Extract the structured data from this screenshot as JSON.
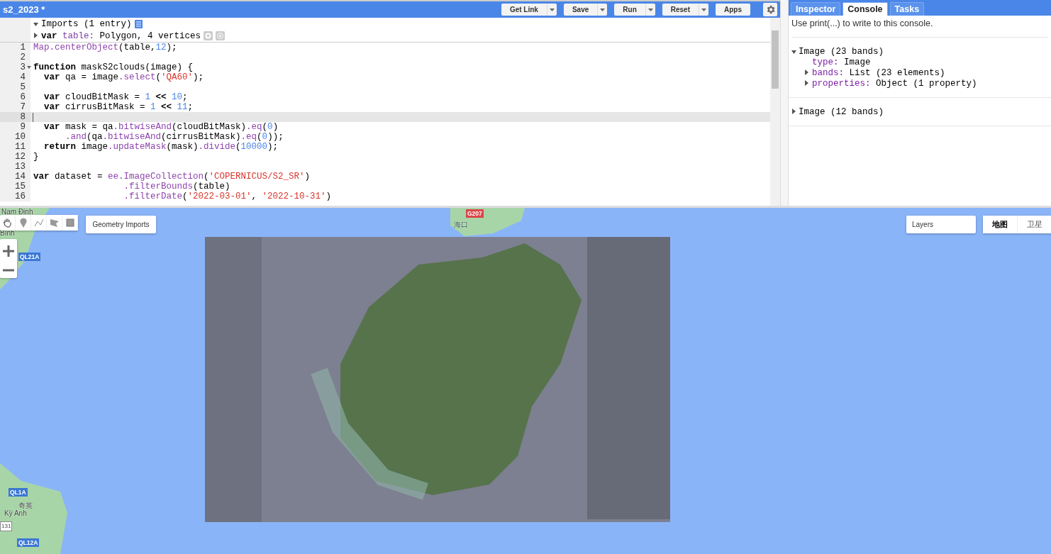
{
  "editor": {
    "title": "s2_2023 *",
    "buttons": [
      {
        "label": "Get Link",
        "dropdown": true
      },
      {
        "label": "Save",
        "dropdown": true
      },
      {
        "label": "Run",
        "dropdown": true
      },
      {
        "label": "Reset",
        "dropdown": true
      },
      {
        "label": "Apps",
        "dropdown": false
      }
    ],
    "imports": {
      "header": "Imports (1 entry)",
      "expanded": true,
      "entry": {
        "keyword": "var",
        "name": "table:",
        "value": "Polygon, 4 vertices",
        "expanded": false
      }
    },
    "lines": [
      {
        "number": "1",
        "foldable": false,
        "current": false,
        "tokens": [
          {
            "kind": "method",
            "text": "Map.centerObject"
          },
          {
            "kind": "plain",
            "text": "(table,"
          },
          {
            "kind": "number",
            "text": "12"
          },
          {
            "kind": "plain",
            "text": ");"
          }
        ]
      },
      {
        "number": "2",
        "foldable": false,
        "current": false
      },
      {
        "number": "3",
        "foldable": true,
        "current": false,
        "tokens": [
          {
            "kind": "keyword",
            "text": "function"
          },
          {
            "kind": "plain",
            "text": " maskS2clouds(image) {"
          }
        ]
      },
      {
        "number": "4",
        "foldable": false,
        "current": false,
        "tokens": [
          {
            "kind": "keyword",
            "text": "  var"
          },
          {
            "kind": "plain",
            "text": " qa = image"
          },
          {
            "kind": "method",
            "text": ".select"
          },
          {
            "kind": "plain",
            "text": "("
          },
          {
            "kind": "string",
            "text": "'QA60'"
          },
          {
            "kind": "plain",
            "text": ");"
          }
        ]
      },
      {
        "number": "5",
        "foldable": false,
        "current": false
      },
      {
        "number": "6",
        "foldable": false,
        "current": false,
        "tokens": [
          {
            "kind": "keyword",
            "text": "  var"
          },
          {
            "kind": "plain",
            "text": " cloudBitMask = "
          },
          {
            "kind": "number",
            "text": "1"
          },
          {
            "kind": "keyword",
            "text": " << "
          },
          {
            "kind": "number",
            "text": "10"
          },
          {
            "kind": "plain",
            "text": ";"
          }
        ]
      },
      {
        "number": "7",
        "foldable": false,
        "current": false,
        "tokens": [
          {
            "kind": "keyword",
            "text": "  var"
          },
          {
            "kind": "plain",
            "text": " cirrusBitMask = "
          },
          {
            "kind": "number",
            "text": "1"
          },
          {
            "kind": "keyword",
            "text": " << "
          },
          {
            "kind": "number",
            "text": "11"
          },
          {
            "kind": "plain",
            "text": ";"
          }
        ]
      },
      {
        "number": "8",
        "foldable": false,
        "current": true
      },
      {
        "number": "9",
        "foldable": false,
        "current": false,
        "tokens": [
          {
            "kind": "keyword",
            "text": "  var"
          },
          {
            "kind": "plain",
            "text": " mask = qa"
          },
          {
            "kind": "method",
            "text": ".bitwiseAnd"
          },
          {
            "kind": "plain",
            "text": "(cloudBitMask)"
          },
          {
            "kind": "method",
            "text": ".eq"
          },
          {
            "kind": "plain",
            "text": "("
          },
          {
            "kind": "number",
            "text": "0"
          },
          {
            "kind": "plain",
            "text": ")"
          }
        ]
      },
      {
        "number": "10",
        "foldable": false,
        "current": false,
        "tokens": [
          {
            "kind": "method",
            "text": "      .and"
          },
          {
            "kind": "plain",
            "text": "(qa"
          },
          {
            "kind": "method",
            "text": ".bitwiseAnd"
          },
          {
            "kind": "plain",
            "text": "(cirrusBitMask)"
          },
          {
            "kind": "method",
            "text": ".eq"
          },
          {
            "kind": "plain",
            "text": "("
          },
          {
            "kind": "number",
            "text": "0"
          },
          {
            "kind": "plain",
            "text": "));"
          }
        ]
      },
      {
        "number": "11",
        "foldable": false,
        "current": false,
        "tokens": [
          {
            "kind": "keyword",
            "text": "  return"
          },
          {
            "kind": "plain",
            "text": " image"
          },
          {
            "kind": "method",
            "text": ".updateMask"
          },
          {
            "kind": "plain",
            "text": "(mask)"
          },
          {
            "kind": "method",
            "text": ".divide"
          },
          {
            "kind": "plain",
            "text": "("
          },
          {
            "kind": "number",
            "text": "10000"
          },
          {
            "kind": "plain",
            "text": ");"
          }
        ]
      },
      {
        "number": "12",
        "foldable": false,
        "current": false,
        "tokens": [
          {
            "kind": "plain",
            "text": "}"
          }
        ]
      },
      {
        "number": "13",
        "foldable": false,
        "current": false
      },
      {
        "number": "14",
        "foldable": false,
        "current": false,
        "tokens": [
          {
            "kind": "keyword",
            "text": "var"
          },
          {
            "kind": "plain",
            "text": " dataset = "
          },
          {
            "kind": "method",
            "text": "ee.ImageCollection"
          },
          {
            "kind": "plain",
            "text": "("
          },
          {
            "kind": "string",
            "text": "'COPERNICUS/S2_SR'"
          },
          {
            "kind": "plain",
            "text": ")"
          }
        ]
      },
      {
        "number": "15",
        "foldable": false,
        "current": false,
        "tokens": [
          {
            "kind": "method",
            "text": "                 .filterBounds"
          },
          {
            "kind": "plain",
            "text": "(table)"
          }
        ]
      },
      {
        "number": "16",
        "foldable": false,
        "current": false,
        "tokens": [
          {
            "kind": "method",
            "text": "                 .filterDate"
          },
          {
            "kind": "plain",
            "text": "("
          },
          {
            "kind": "string",
            "text": "'2022-03-01'"
          },
          {
            "kind": "plain",
            "text": ", "
          },
          {
            "kind": "string",
            "text": "'2022-10-31'"
          },
          {
            "kind": "plain",
            "text": ")"
          }
        ]
      }
    ]
  },
  "console": {
    "tabs": [
      {
        "label": "Inspector",
        "selected": false
      },
      {
        "label": "Console",
        "selected": true
      },
      {
        "label": "Tasks",
        "selected": false
      }
    ],
    "hint": "Use print(...) to write to this console.",
    "entries": [
      {
        "label": "Image (23 bands)",
        "expanded": true,
        "children": [
          {
            "key": "type:",
            "value": "Image",
            "expandable": false
          },
          {
            "key": "bands:",
            "value": "List (23 elements)",
            "expandable": true
          },
          {
            "key": "properties:",
            "value": "Object (1 property)",
            "expandable": true
          }
        ]
      },
      {
        "label": "Image (12 bands)",
        "expanded": false
      }
    ]
  },
  "map": {
    "geometry_button": "Geometry Imports",
    "layers_button": "Layers",
    "map_types": [
      {
        "label": "地图",
        "selected": true
      },
      {
        "label": "卫星",
        "selected": false
      }
    ],
    "labels": [
      {
        "text": "Nam Định",
        "kind": "place"
      },
      {
        "text": "Bình",
        "kind": "place"
      },
      {
        "text": "QL21A",
        "kind": "road"
      },
      {
        "text": "G207",
        "kind": "highway"
      },
      {
        "text": "海口",
        "kind": "city"
      },
      {
        "text": "QL1A",
        "kind": "road"
      },
      {
        "text": "奇英",
        "kind": "place"
      },
      {
        "text": "Kỳ Anh",
        "kind": "place"
      },
      {
        "text": "131",
        "kind": "minor"
      },
      {
        "text": "QL12A",
        "kind": "road"
      }
    ]
  }
}
